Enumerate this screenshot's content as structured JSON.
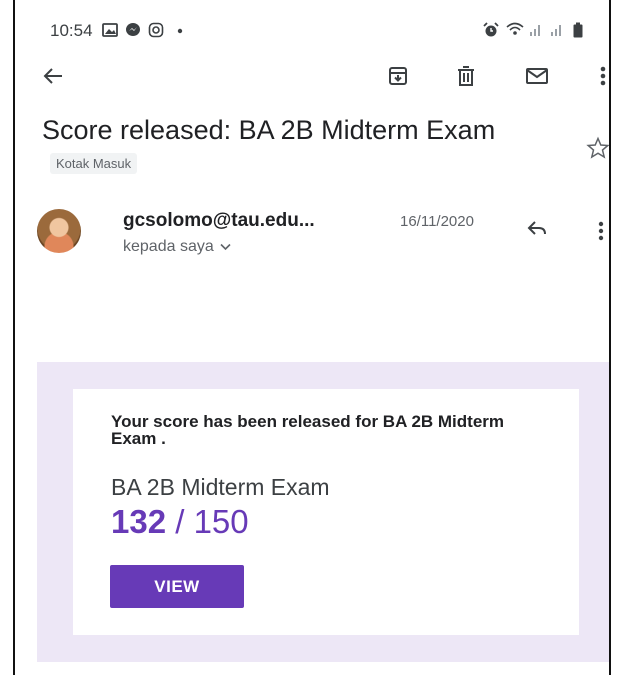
{
  "status_bar": {
    "time": "10:54",
    "left_icons": [
      "gallery-icon",
      "messenger-icon",
      "instagram-icon",
      "dot-icon"
    ],
    "right_icons": [
      "alarm-icon",
      "wifi-icon",
      "signal-icon",
      "signal-icon",
      "battery-icon"
    ]
  },
  "toolbar": {
    "back_icon": "arrow-left-icon",
    "actions": [
      "archive-icon",
      "delete-icon",
      "mark-unread-icon",
      "more-vert-icon"
    ]
  },
  "email": {
    "subject": "Score released: BA 2B Midterm Exam",
    "label": "Kotak Masuk",
    "sender": "gcsolomo@tau.edu...",
    "date": "16/11/2020",
    "recipient": "kepada saya"
  },
  "card": {
    "message": "Your score has been released for BA 2B Midterm Exam .",
    "exam_name": "BA 2B Midterm Exam",
    "score": "132",
    "separator": " / ",
    "total": "150",
    "view_label": "VIEW"
  },
  "colors": {
    "accent": "#673ab7",
    "card_background": "#ede7f6",
    "label_chip": "#f1f3f4"
  }
}
